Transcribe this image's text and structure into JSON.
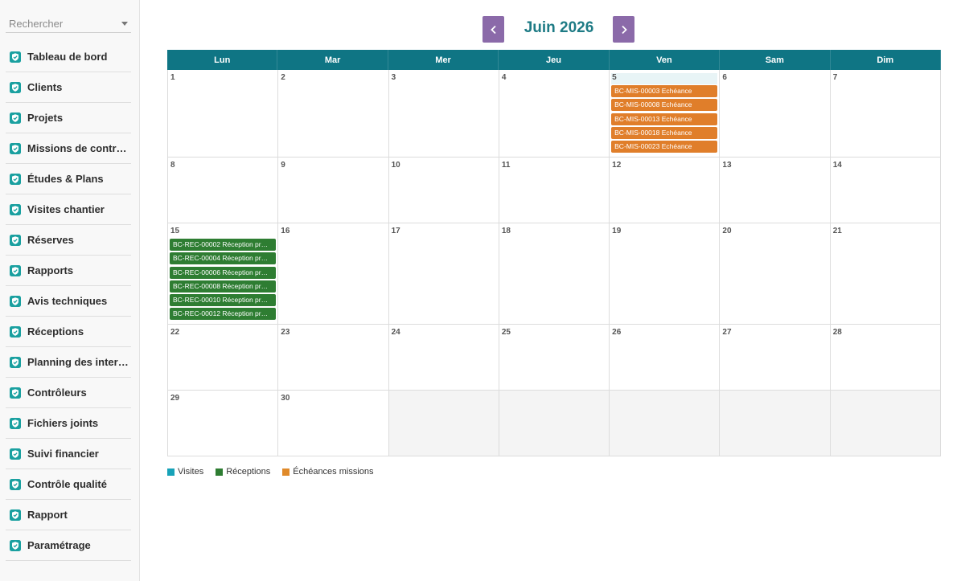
{
  "sidebar": {
    "search_placeholder": "Rechercher",
    "items": [
      {
        "label": "Tableau de bord",
        "name": "sidebar-item-tableau-de-bord"
      },
      {
        "label": "Clients",
        "name": "sidebar-item-clients"
      },
      {
        "label": "Projets",
        "name": "sidebar-item-projets"
      },
      {
        "label": "Missions de contrôle",
        "name": "sidebar-item-missions-de-controle"
      },
      {
        "label": "Études & Plans",
        "name": "sidebar-item-etudes-plans"
      },
      {
        "label": "Visites chantier",
        "name": "sidebar-item-visites-chantier"
      },
      {
        "label": "Réserves",
        "name": "sidebar-item-reserves"
      },
      {
        "label": "Rapports",
        "name": "sidebar-item-rapports"
      },
      {
        "label": "Avis techniques",
        "name": "sidebar-item-avis-techniques"
      },
      {
        "label": "Réceptions",
        "name": "sidebar-item-receptions"
      },
      {
        "label": "Planning des interv…",
        "name": "sidebar-item-planning"
      },
      {
        "label": "Contrôleurs",
        "name": "sidebar-item-controleurs"
      },
      {
        "label": "Fichiers joints",
        "name": "sidebar-item-fichiers-joints"
      },
      {
        "label": "Suivi financier",
        "name": "sidebar-item-suivi-financier"
      },
      {
        "label": "Contrôle qualité",
        "name": "sidebar-item-controle-qualite"
      },
      {
        "label": "Rapport",
        "name": "sidebar-item-rapport"
      },
      {
        "label": "Paramétrage",
        "name": "sidebar-item-parametrage"
      }
    ],
    "icon_color": "#1aa0a0"
  },
  "calendar": {
    "title": "Juin 2026",
    "weekdays": [
      "Lun",
      "Mar",
      "Mer",
      "Jeu",
      "Ven",
      "Sam",
      "Dim"
    ],
    "colors": {
      "header": "#0f7584",
      "nav": "#8b6aa9",
      "title": "#1e7b85"
    },
    "weeks": [
      {
        "days": [
          {
            "num": "1",
            "events": []
          },
          {
            "num": "2",
            "events": []
          },
          {
            "num": "3",
            "events": []
          },
          {
            "num": "4",
            "events": []
          },
          {
            "num": "5",
            "today": true,
            "events": [
              {
                "label": "BC-MIS-00003 Echéance",
                "kind": "orange"
              },
              {
                "label": "BC-MIS-00008 Echéance",
                "kind": "orange"
              },
              {
                "label": "BC-MIS-00013 Echéance",
                "kind": "orange"
              },
              {
                "label": "BC-MIS-00018 Echéance",
                "kind": "orange"
              },
              {
                "label": "BC-MIS-00023 Echéance",
                "kind": "orange"
              }
            ]
          },
          {
            "num": "6",
            "events": []
          },
          {
            "num": "7",
            "events": []
          }
        ]
      },
      {
        "days": [
          {
            "num": "8",
            "events": []
          },
          {
            "num": "9",
            "events": []
          },
          {
            "num": "10",
            "events": []
          },
          {
            "num": "11",
            "events": []
          },
          {
            "num": "12",
            "events": []
          },
          {
            "num": "13",
            "events": []
          },
          {
            "num": "14",
            "events": []
          }
        ]
      },
      {
        "days": [
          {
            "num": "15",
            "events": [
              {
                "label": "BC-REC-00002 Réception pr…",
                "kind": "green"
              },
              {
                "label": "BC-REC-00004 Réception pr…",
                "kind": "green"
              },
              {
                "label": "BC-REC-00006 Réception pr…",
                "kind": "green"
              },
              {
                "label": "BC-REC-00008 Réception pr…",
                "kind": "green"
              },
              {
                "label": "BC-REC-00010 Réception pr…",
                "kind": "green"
              },
              {
                "label": "BC-REC-00012 Réception pr…",
                "kind": "green"
              }
            ]
          },
          {
            "num": "16",
            "events": []
          },
          {
            "num": "17",
            "events": []
          },
          {
            "num": "18",
            "events": []
          },
          {
            "num": "19",
            "events": []
          },
          {
            "num": "20",
            "events": []
          },
          {
            "num": "21",
            "events": []
          }
        ]
      },
      {
        "days": [
          {
            "num": "22",
            "events": []
          },
          {
            "num": "23",
            "events": []
          },
          {
            "num": "24",
            "events": []
          },
          {
            "num": "25",
            "events": []
          },
          {
            "num": "26",
            "events": []
          },
          {
            "num": "27",
            "events": []
          },
          {
            "num": "28",
            "events": []
          }
        ]
      },
      {
        "days": [
          {
            "num": "29",
            "events": []
          },
          {
            "num": "30",
            "events": []
          },
          {
            "num": "",
            "empty": true,
            "events": []
          },
          {
            "num": "",
            "empty": true,
            "events": []
          },
          {
            "num": "",
            "empty": true,
            "events": []
          },
          {
            "num": "",
            "empty": true,
            "events": []
          },
          {
            "num": "",
            "empty": true,
            "events": []
          }
        ]
      }
    ]
  },
  "legend": [
    {
      "label": "Visites",
      "color": "#17a2b8"
    },
    {
      "label": "Réceptions",
      "color": "#2e7d32"
    },
    {
      "label": "Échéances missions",
      "color": "#e08a2a"
    }
  ]
}
